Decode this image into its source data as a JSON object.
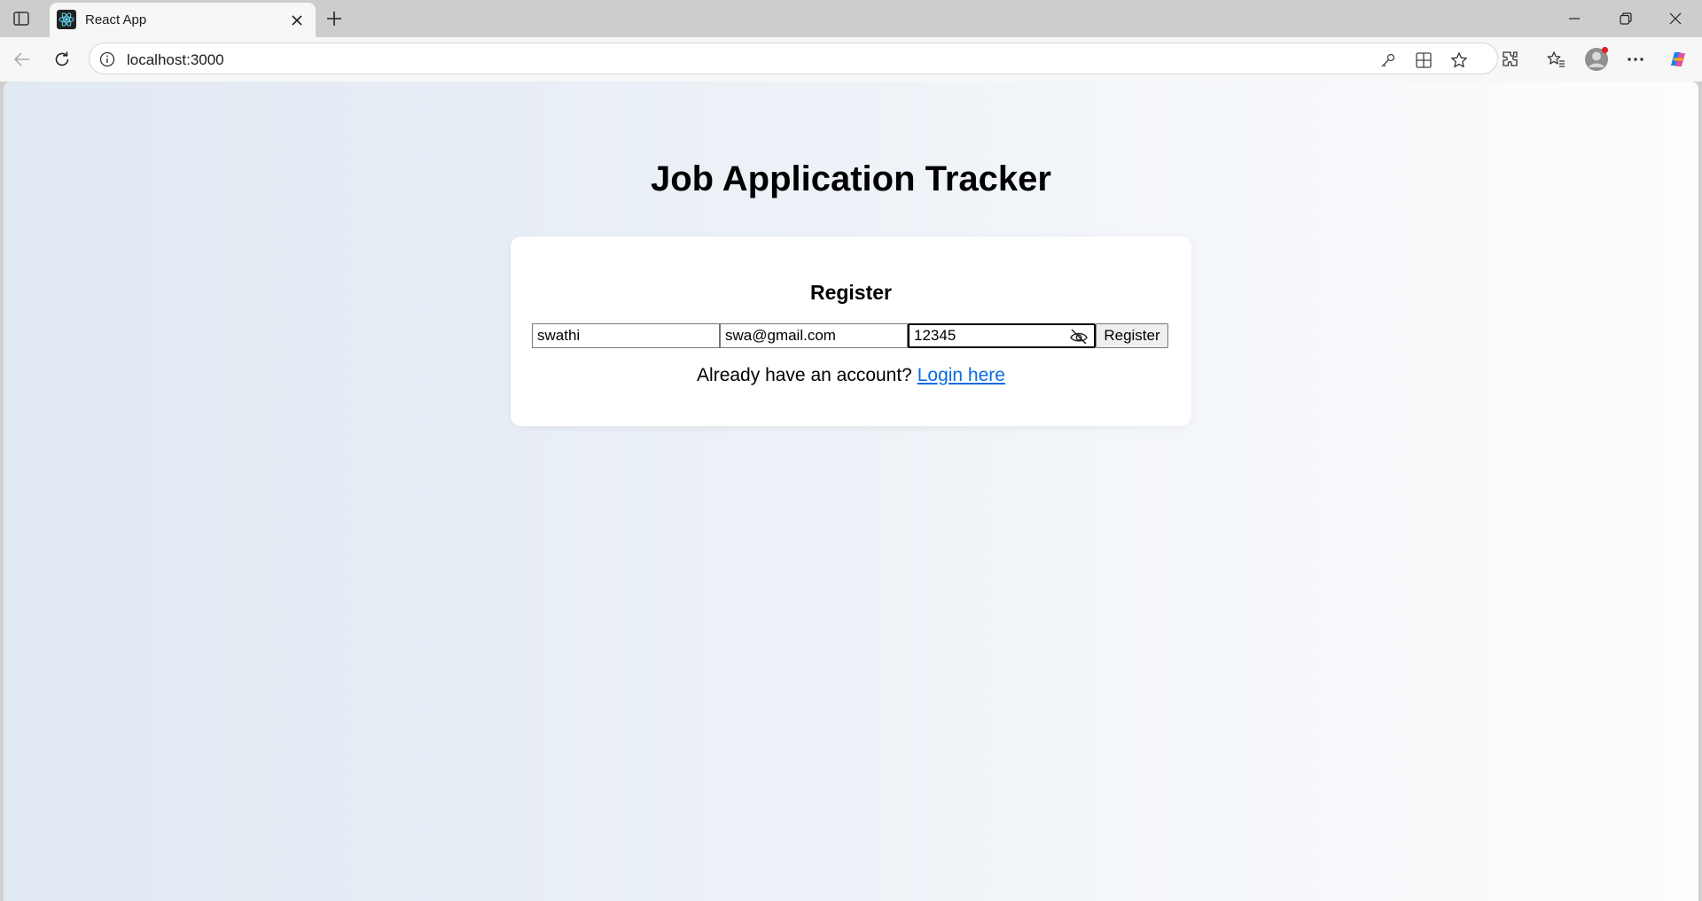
{
  "browser": {
    "tab_title": "React App",
    "url": "localhost:3000",
    "icons": [
      "sidebar-toggle-icon",
      "react-logo-icon",
      "close-icon",
      "plus-icon",
      "minimize-icon",
      "restore-icon",
      "close-window-icon",
      "back-icon",
      "refresh-icon",
      "info-icon",
      "key-icon",
      "app-grid-icon",
      "star-icon",
      "extensions-icon",
      "favorites-icon",
      "profile-icon",
      "more-icon",
      "copilot-icon"
    ]
  },
  "page": {
    "title": "Job Application Tracker",
    "form_heading": "Register",
    "name_value": "swathi",
    "email_value": "swa@gmail.com",
    "password_value": "12345",
    "submit_label": "Register",
    "login_prompt": "Already have an account?",
    "login_link": "Login here"
  },
  "colors": {
    "link": "#0a6ce0",
    "card_bg": "#ffffff"
  }
}
